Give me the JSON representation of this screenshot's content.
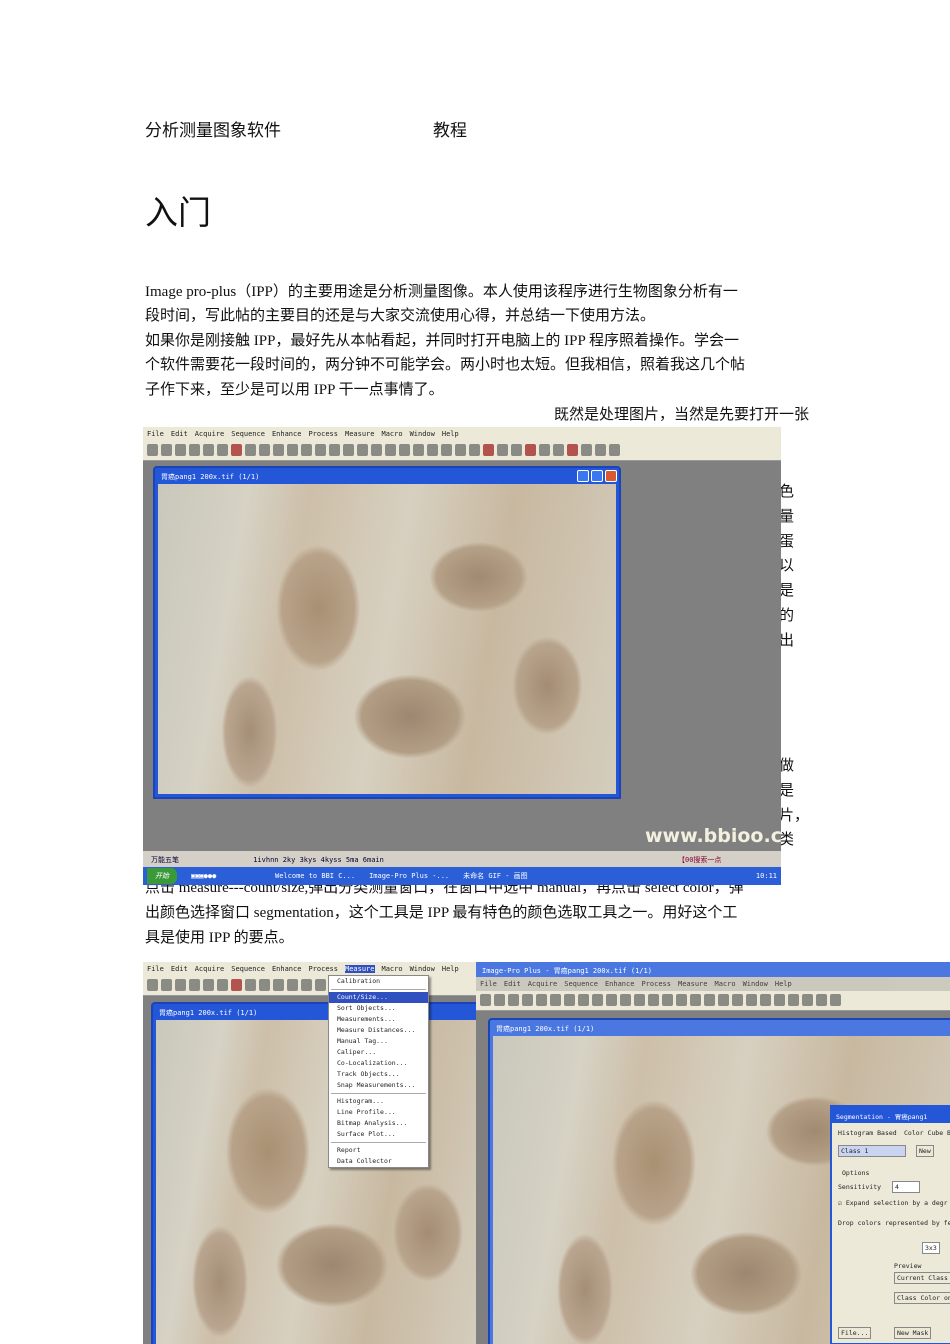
{
  "header": {
    "title": "分析测量图象软件",
    "suffix": "教程"
  },
  "section_title": "入门",
  "paragraph_lines": [
    "Image pro-plus（IPP）的主要用途是分析测量图像。本人使用该程序进行生物图象分析有一",
    "段时间，写此帖的主要目的还是与大家交流使用心得，并总结一下使用方法。",
    "如果你是刚接触 IPP，最好先从本帖看起，并同时打开电脑上的 IPP 程序照着操作。学会一",
    "个软件需要花一段时间的，两分钟不可能学会。两小时也太短。但我相信，照着我这几个帖",
    "子作下来，至少是可以用 IPP 干一点事情了。"
  ],
  "right_line": "既然是处理图片，当然是先要打开一张",
  "obscured_fragments": [
    "色",
    "量",
    "蛋",
    "以",
    "是",
    "的",
    "出",
    "做",
    "是",
    "片，",
    "类"
  ],
  "after_lines": [
    "点击 measure---count/size,弹出分类测量窗口，在窗口中选中 manual，再点击 select color，弹",
    "出颜色选择窗口 segmentation，这个工具是 IPP 最有特色的颜色选取工具之一。用好这个工",
    "具是使用 IPP 的要点。"
  ],
  "app": {
    "menu": [
      "File",
      "Edit",
      "Acquire",
      "Sequence",
      "Enhance",
      "Process",
      "Measure",
      "Macro",
      "Window",
      "Help"
    ],
    "image_window_title": "胃癌pang1  200x.tif (1/1)",
    "main_title": "Image-Pro Plus - 胃癌pang1  200x.tif (1/1)",
    "watermark": "www.bbioo.com",
    "taskbar_top": "1ivhnn 2ky 3kys 4kyss 5ma 6main",
    "taskbar_left": "万能五笔",
    "taskbar_search": "【00搜索一点",
    "start": "开始",
    "tasks": [
      "Welcome to BBI C...",
      "Image-Pro Plus -...",
      "未命名 GIF - 画图"
    ],
    "clock": "10:11"
  },
  "measure_menu": {
    "items": [
      "Calibration",
      "Count/Size...",
      "Sort Objects...",
      "Measurements...",
      "Measure Distances...",
      "Manual Tag...",
      "Caliper...",
      "Co-Localization...",
      "Track Objects...",
      "Snap Measurements...",
      "Histogram...",
      "Line Profile...",
      "Bitmap Analysis...",
      "Surface Plot...",
      "Report",
      "Data Collector"
    ]
  },
  "segmentation": {
    "title": "Segmentation - 胃癌pang1",
    "tabs": [
      "Histogram Based",
      "Color Cube B"
    ],
    "class": "Class 1",
    "new": "New",
    "options": "Options",
    "sensitivity_label": "Sensitivity",
    "sensitivity": "4",
    "expand": "Expand selection by a degr",
    "drop": "Drop colors represented by fe",
    "size": "3x3",
    "preview": "Preview",
    "current_class": "Current Class",
    "class_color": "Class Color on",
    "file": "File...",
    "new_mask": "New Mask"
  }
}
